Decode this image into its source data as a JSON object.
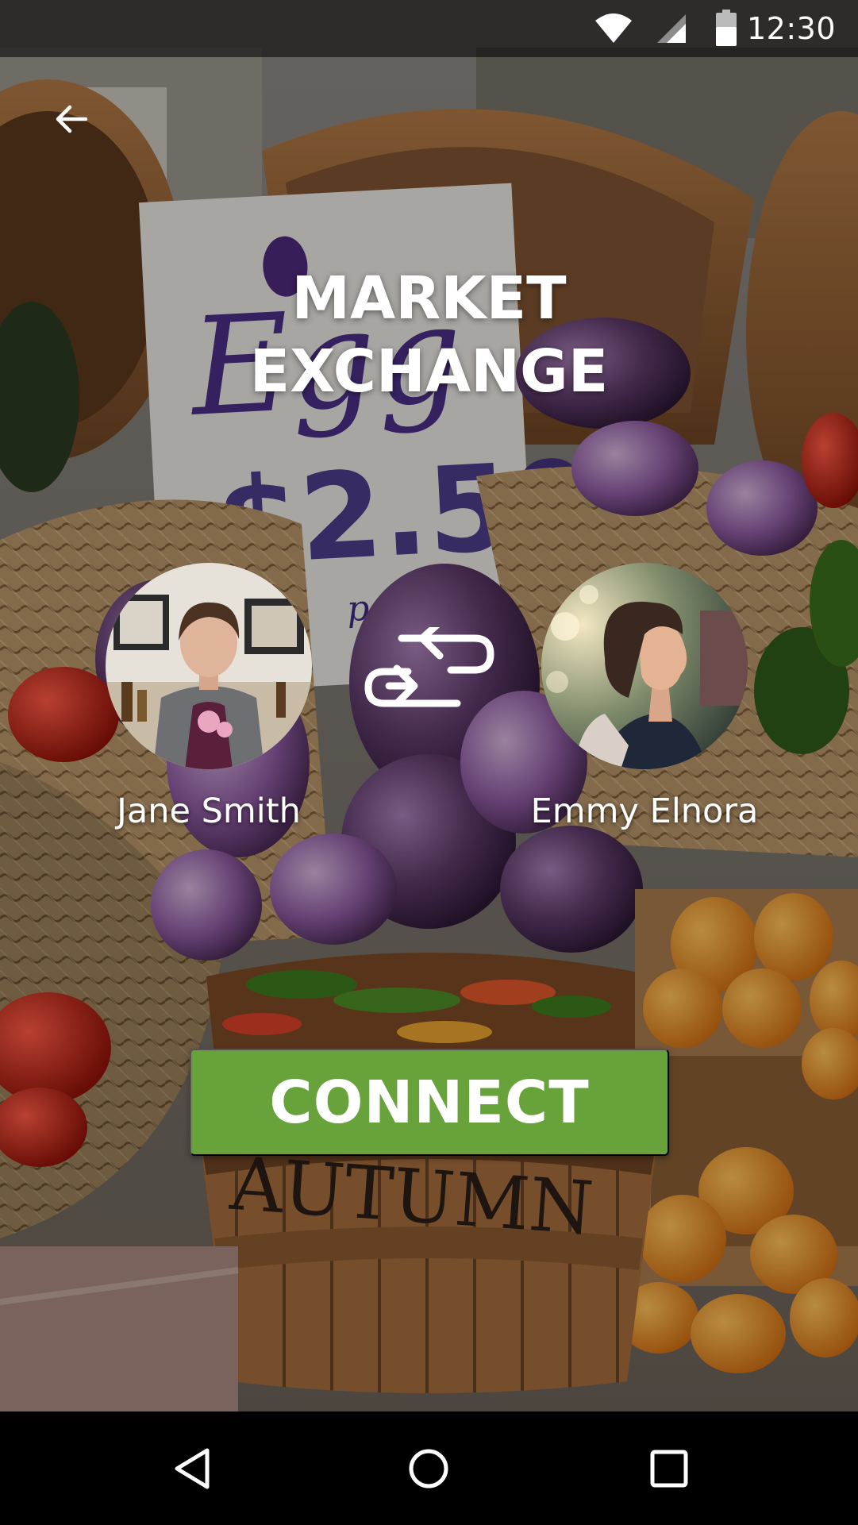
{
  "app": {
    "title_line1": "MARKET",
    "title_line2": "EXCHANGE"
  },
  "status_bar": {
    "time": "12:30",
    "icons": [
      "wifi-icon",
      "cell-signal-icon",
      "battery-icon"
    ]
  },
  "toolbar": {
    "back_icon": "arrow-back-icon"
  },
  "users": [
    {
      "name": "Jane Smith",
      "avatar_icon": "avatar-photo"
    },
    {
      "name": "Emmy Elnora",
      "avatar_icon": "avatar-photo"
    }
  ],
  "exchange": {
    "icon": "swap-arrows-icon"
  },
  "actions": {
    "connect_label": "CONNECT"
  },
  "background_sign": {
    "word": "Eggplant",
    "price": "$2.50",
    "unit": "per lb",
    "basket_label": "AUTUMN"
  },
  "nav_bar": {
    "icons": [
      "nav-back-icon",
      "nav-home-icon",
      "nav-recents-icon"
    ]
  },
  "colors": {
    "accent": "#67a23a",
    "text": "#ffffff",
    "status_bar": "#000000"
  }
}
